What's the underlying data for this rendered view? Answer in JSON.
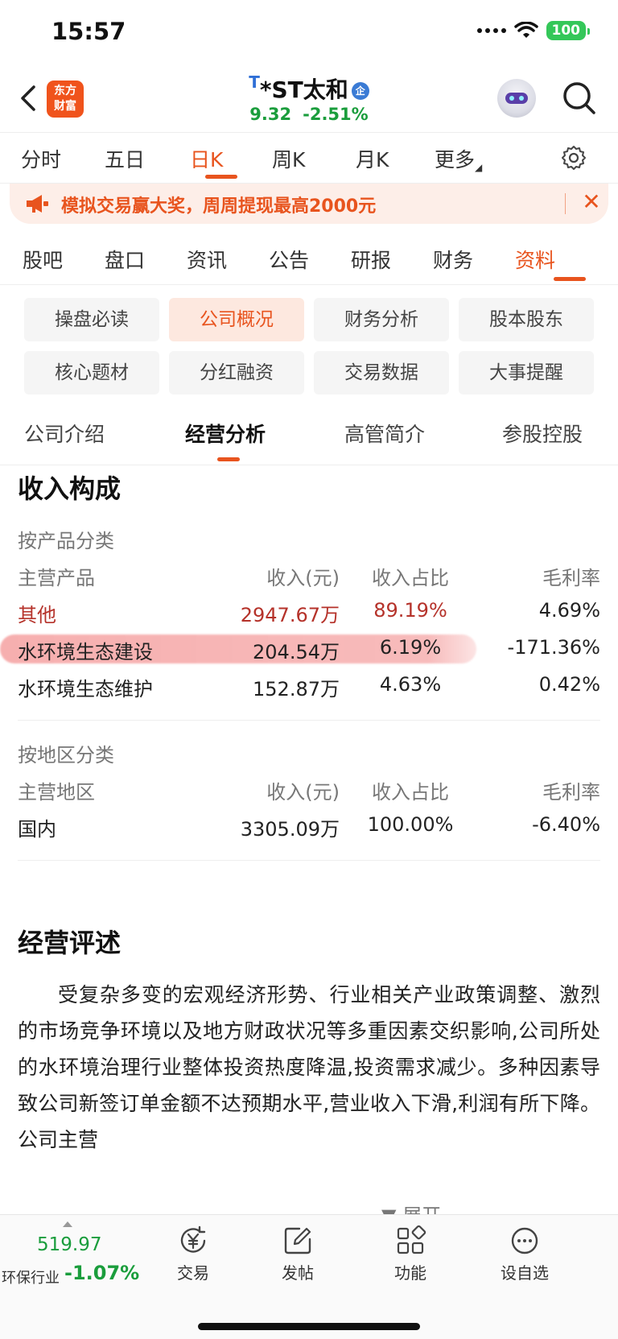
{
  "status": {
    "time": "15:57",
    "battery": "100"
  },
  "header": {
    "logo_line1": "东方",
    "logo_line2": "财富",
    "t_mark": "T",
    "stock_name": "*ST太和",
    "badge": "企",
    "price": "9.32",
    "change": "-2.51%"
  },
  "chart_tabs": [
    "分时",
    "五日",
    "日K",
    "周K",
    "月K",
    "更多"
  ],
  "active_chart_tab": "日K",
  "promo": {
    "text": "模拟交易赢大奖，周周提现最高2000元"
  },
  "section_tabs": [
    "股吧",
    "盘口",
    "资讯",
    "公告",
    "研报",
    "财务",
    "资料"
  ],
  "active_section_tab": "资料",
  "chips": [
    "操盘必读",
    "公司概况",
    "财务分析",
    "股本股东",
    "核心题材",
    "分红融资",
    "交易数据",
    "大事提醒"
  ],
  "active_chip": "公司概况",
  "sub_tabs": [
    "公司介绍",
    "经营分析",
    "高管简介",
    "参股控股"
  ],
  "active_sub_tab": "经营分析",
  "income": {
    "title": "收入构成",
    "by_product": {
      "label": "按产品分类",
      "headers": [
        "主营产品",
        "收入(元)",
        "收入占比",
        "毛利率"
      ],
      "rows": [
        [
          "其他",
          "2947.67万",
          "89.19%",
          "4.69%"
        ],
        [
          "水环境生态建设",
          "204.54万",
          "6.19%",
          "-171.36%"
        ],
        [
          "水环境生态维护",
          "152.87万",
          "4.63%",
          "0.42%"
        ]
      ]
    },
    "by_region": {
      "label": "按地区分类",
      "headers": [
        "主营地区",
        "收入(元)",
        "收入占比",
        "毛利率"
      ],
      "rows": [
        [
          "国内",
          "3305.09万",
          "100.00%",
          "-6.40%"
        ]
      ]
    }
  },
  "review": {
    "title": "经营评述",
    "text": "受复杂多变的宏观经济形势、行业相关产业政策调整、激烈的市场竞争环境以及地方财政状况等多重因素交织影响,公司所处的水环境治理行业整体投资热度降温,投资需求减少。多种因素导致公司新签订单金额不达预期水平,营业收入下滑,利润有所下降。公司主营",
    "expand": "展开"
  },
  "bottom": {
    "sector_value": "519.97",
    "sector_name": "环保行业",
    "sector_change": "-1.07%",
    "tools": [
      "交易",
      "发帖",
      "功能",
      "设自选"
    ]
  },
  "colors": {
    "accent": "#e8541e",
    "down": "#1a9d3c",
    "highlight": "#f07070"
  }
}
